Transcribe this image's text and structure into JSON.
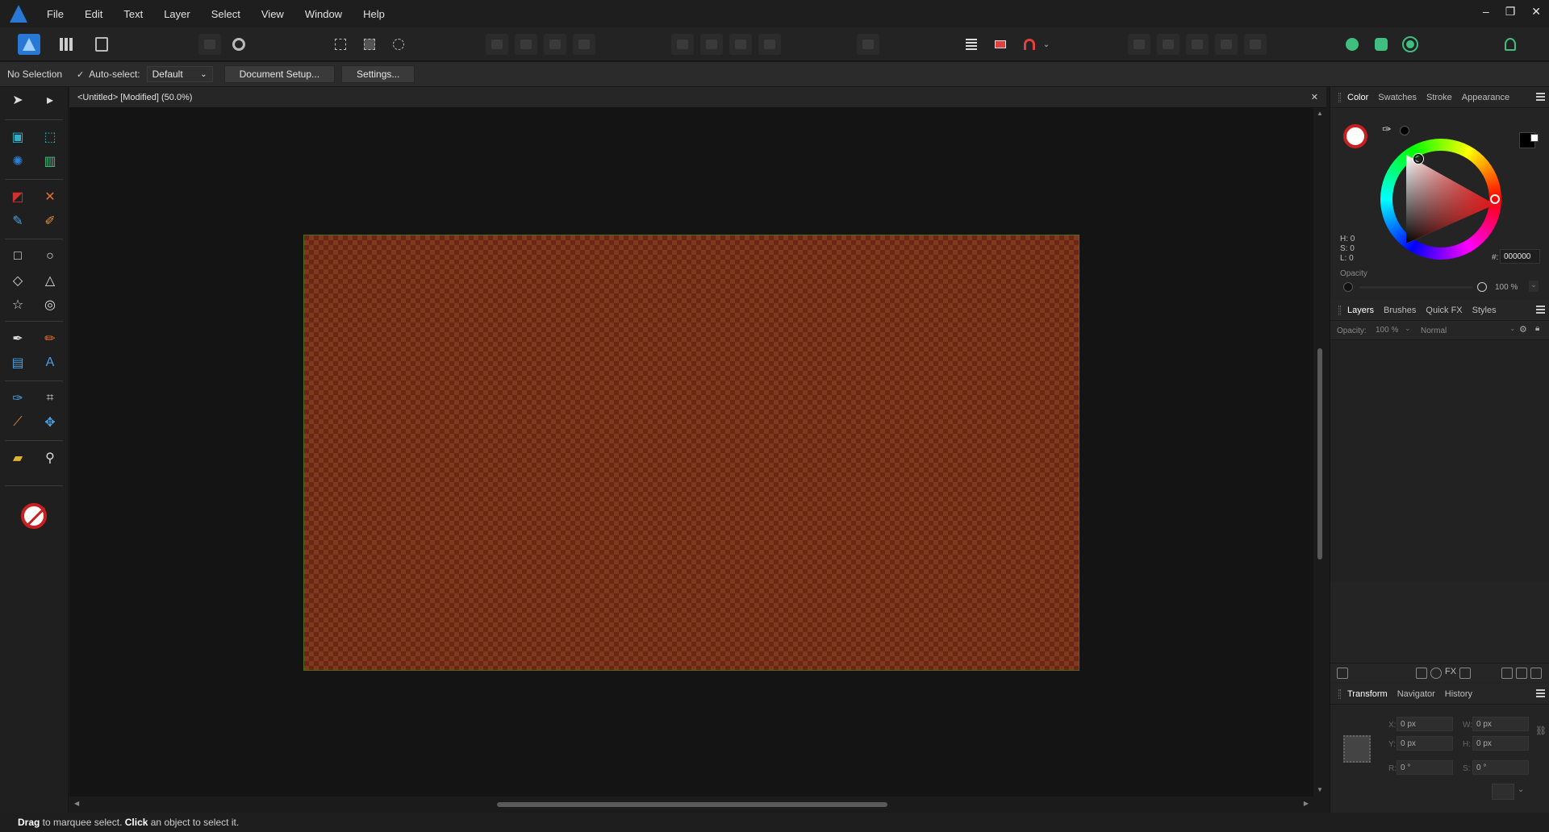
{
  "menu": {
    "items": [
      "File",
      "Edit",
      "Text",
      "Layer",
      "Select",
      "View",
      "Window",
      "Help"
    ]
  },
  "window_controls": {
    "minimize": "–",
    "restore": "❐",
    "close": "✕"
  },
  "context": {
    "selection": "No Selection",
    "autoselect_label": "Auto-select:",
    "autoselect_value": "Default",
    "document_setup": "Document Setup...",
    "settings": "Settings..."
  },
  "document": {
    "tab_title": "<Untitled> [Modified] (50.0%)",
    "close_glyph": "✕"
  },
  "colors": {
    "artboard_a": "#6b2616",
    "artboard_b": "#7d3a1c",
    "accent": "#2a78d6"
  },
  "color_panel": {
    "tabs": [
      "Color",
      "Swatches",
      "Stroke",
      "Appearance"
    ],
    "h": "H: 0",
    "s": "S: 0",
    "l": "L: 0",
    "hex_label": "#:",
    "hex_value": "000000",
    "opacity_label": "Opacity",
    "opacity_value": "100 %"
  },
  "layers_panel": {
    "tabs": [
      "Layers",
      "Brushes",
      "Quick FX",
      "Styles"
    ],
    "opacity_label": "Opacity:",
    "opacity_value": "100 %",
    "blend_mode": "Normal"
  },
  "transform_panel": {
    "tabs": [
      "Transform",
      "Navigator",
      "History"
    ],
    "x_label": "X:",
    "x_value": "0 px",
    "y_label": "Y:",
    "y_value": "0 px",
    "w_label": "W:",
    "w_value": "0 px",
    "h_label": "H:",
    "h_value": "0 px",
    "r_label": "R:",
    "r_value": "0 °",
    "s_label": "S:",
    "s_value": "0 °"
  },
  "status": {
    "drag": "Drag",
    "drag_text": " to marquee select. ",
    "click": "Click",
    "click_text": " an object to select it."
  }
}
